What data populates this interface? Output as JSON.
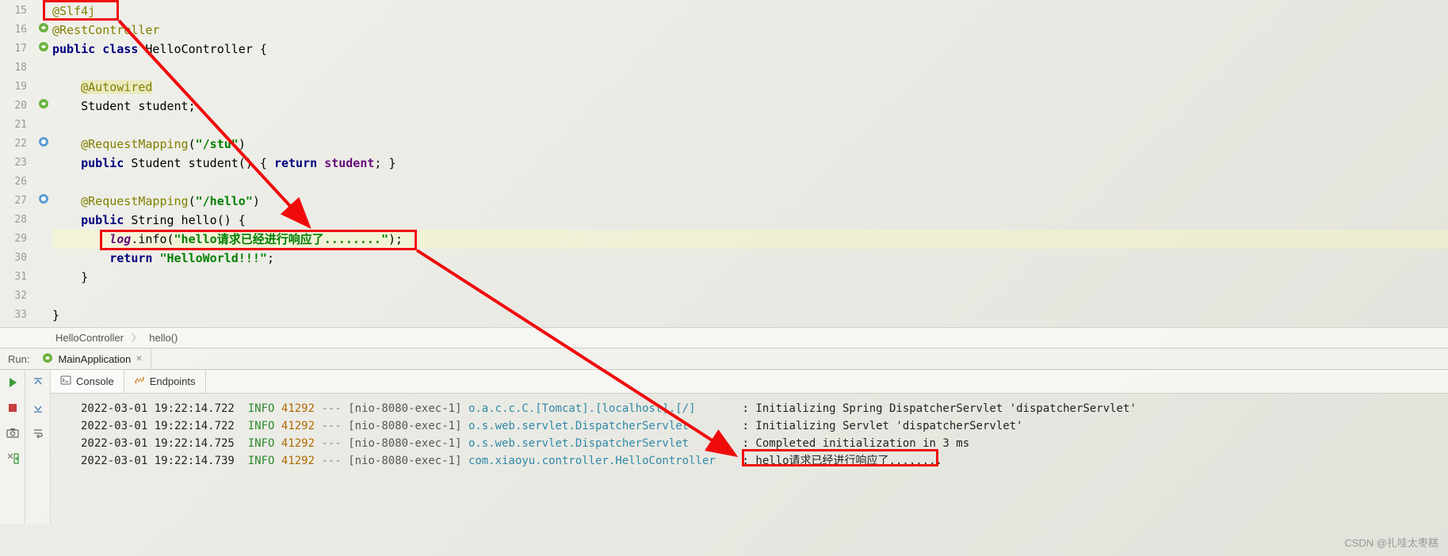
{
  "editor": {
    "lines": [
      {
        "num": "15",
        "raw": "@Slf4j"
      },
      {
        "num": "16",
        "raw": "@RestController"
      },
      {
        "num": "17",
        "raw": "public class HelloController {"
      },
      {
        "num": "18",
        "raw": ""
      },
      {
        "num": "19",
        "raw": "    @Autowired"
      },
      {
        "num": "20",
        "raw": "    Student student;"
      },
      {
        "num": "21",
        "raw": ""
      },
      {
        "num": "22",
        "raw": "    @RequestMapping(\"/stu\")"
      },
      {
        "num": "23",
        "raw": "    public Student student() { return student; }"
      },
      {
        "num": "26",
        "raw": ""
      },
      {
        "num": "27",
        "raw": "    @RequestMapping(\"/hello\")"
      },
      {
        "num": "28",
        "raw": "    public String hello() {"
      },
      {
        "num": "29",
        "raw": "        log.info(\"hello请求已经进行响应了........\");"
      },
      {
        "num": "30",
        "raw": "        return \"HelloWorld!!!\";"
      },
      {
        "num": "31",
        "raw": "    }"
      },
      {
        "num": "32",
        "raw": ""
      },
      {
        "num": "33",
        "raw": "}"
      }
    ]
  },
  "breadcrumb": {
    "class": "HelloController",
    "method": "hello()"
  },
  "run": {
    "label": "Run:",
    "tab": "MainApplication"
  },
  "consoleTabs": {
    "console": "Console",
    "endpoints": "Endpoints"
  },
  "log": [
    {
      "ts": "2022-03-01 19:22:14.722",
      "level": "INFO",
      "pid": "41292",
      "thread": "[nio-8080-exec-1]",
      "logger": "o.a.c.c.C.[Tomcat].[localhost].[/]     ",
      "msg": "Initializing Spring DispatcherServlet 'dispatcherServlet'"
    },
    {
      "ts": "2022-03-01 19:22:14.722",
      "level": "INFO",
      "pid": "41292",
      "thread": "[nio-8080-exec-1]",
      "logger": "o.s.web.servlet.DispatcherServlet      ",
      "msg": "Initializing Servlet 'dispatcherServlet'"
    },
    {
      "ts": "2022-03-01 19:22:14.725",
      "level": "INFO",
      "pid": "41292",
      "thread": "[nio-8080-exec-1]",
      "logger": "o.s.web.servlet.DispatcherServlet      ",
      "msg": "Completed initialization in 3 ms"
    },
    {
      "ts": "2022-03-01 19:22:14.739",
      "level": "INFO",
      "pid": "41292",
      "thread": "[nio-8080-exec-1]",
      "logger": "com.xiaoyu.controller.HelloController  ",
      "msg": "hello请求已经进行响应了........"
    }
  ],
  "watermark": "CSDN @扎哇太枣糕"
}
